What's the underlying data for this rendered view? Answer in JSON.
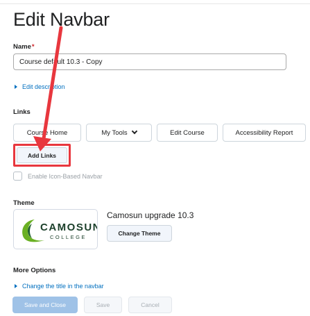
{
  "page": {
    "title": "Edit Navbar"
  },
  "name_field": {
    "label": "Name",
    "required_mark": "*",
    "value": "Course default 10.3 - Copy"
  },
  "description": {
    "toggle_label": "Edit description"
  },
  "links": {
    "section_label": "Links",
    "items": [
      {
        "label": "Course Home"
      },
      {
        "label": "My Tools"
      },
      {
        "label": "Edit Course"
      },
      {
        "label": "Accessibility Report"
      }
    ],
    "add_links_label": "Add Links"
  },
  "icon_navbar": {
    "checkbox_label": "Enable Icon-Based Navbar"
  },
  "theme": {
    "section_label": "Theme",
    "logo_word": "CAMOSUN",
    "logo_subword": "COLLEGE",
    "name": "Camosun upgrade 10.3",
    "change_label": "Change Theme"
  },
  "more_options": {
    "section_label": "More Options",
    "toggle_label": "Change the title in the navbar"
  },
  "footer": {
    "save_close_label": "Save and Close",
    "save_label": "Save",
    "cancel_label": "Cancel"
  },
  "colors": {
    "link_blue": "#006fbf",
    "annotation_red": "#e8373e",
    "primary_disabled": "#9fc2e7",
    "camosun_green": "#6ab023"
  }
}
